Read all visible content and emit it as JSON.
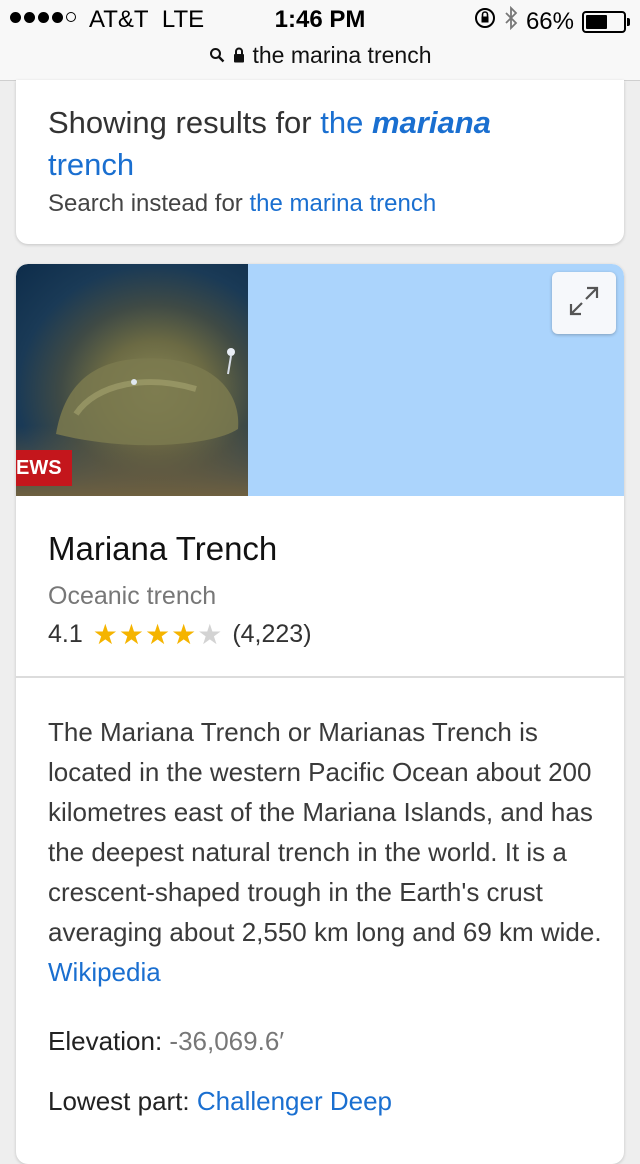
{
  "status_bar": {
    "carrier": "AT&T",
    "network": "LTE",
    "time": "1:46 PM",
    "battery": "66%",
    "battery_level": 0.66
  },
  "url_bar": {
    "query": "the marina trench"
  },
  "spelling": {
    "prefix": "Showing results for",
    "corrected_the": "the",
    "corrected_bold": "mariana",
    "corrected_rest": "trench",
    "instead_prefix": "Search instead for",
    "original_query": "the marina trench"
  },
  "knowledge_panel": {
    "image_badge": "EWS",
    "title": "Mariana Trench",
    "subtitle": "Oceanic trench",
    "rating": "4.1",
    "rating_value": 4.1,
    "review_count": "(4,223)",
    "description": "The Mariana Trench or Marianas Trench is located in the western Pacific Ocean about 200 kilometres east of the Mariana Islands, and has the deepest natural trench in the world. It is a crescent-shaped trough in the Earth's crust averaging about 2,550 km long and 69 km wide.",
    "source_link": "Wikipedia",
    "facts": [
      {
        "label": "Elevation:",
        "value": "-36,069.6′"
      },
      {
        "label": "Lowest part:",
        "value": "Challenger Deep"
      }
    ]
  },
  "colors": {
    "link": "#1a6fd0",
    "star": "#f5b400",
    "map": "#abd4fc"
  }
}
